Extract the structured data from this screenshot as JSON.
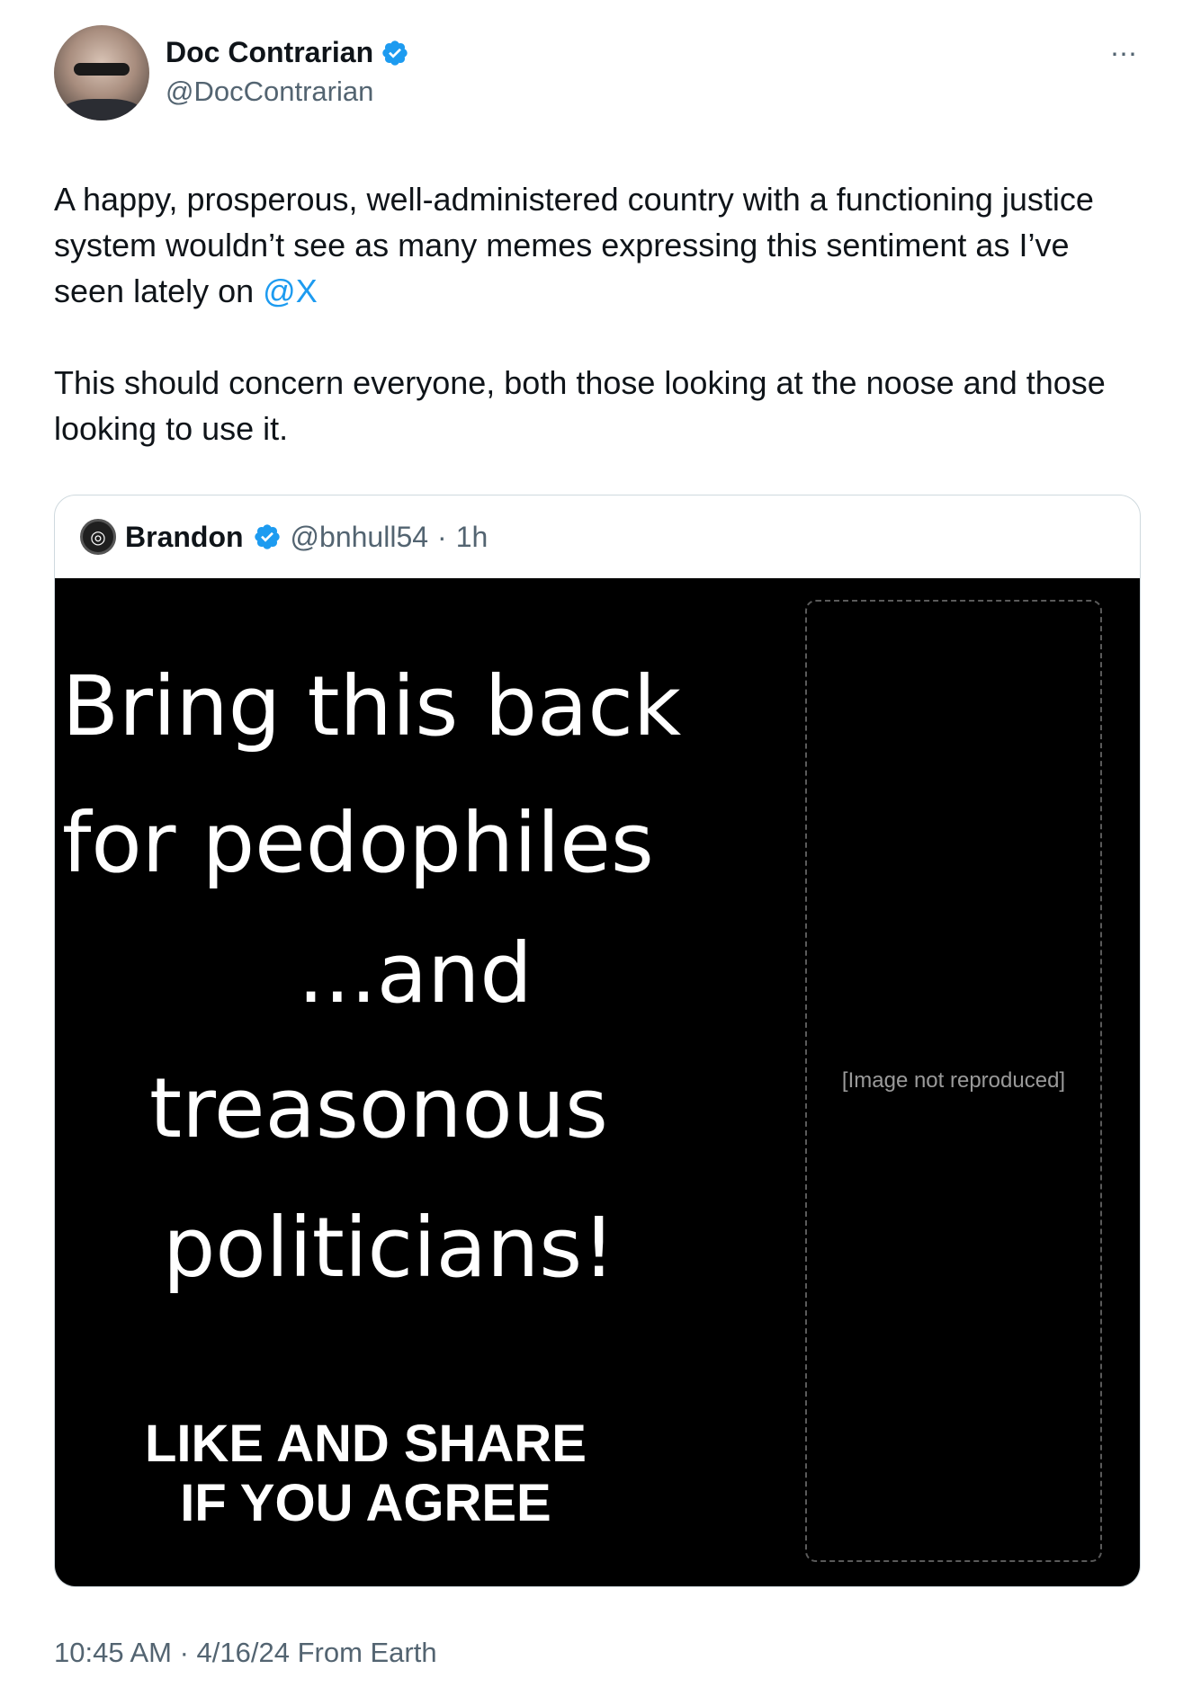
{
  "author": {
    "display_name": "Doc Contrarian",
    "handle": "@DocContrarian",
    "verified": true
  },
  "tweet": {
    "paragraph_1": "A happy, prosperous, well-administered country with a functioning justice system wouldn’t see as many memes expressing this sentiment as I’ve seen lately on ",
    "mention": "@X",
    "paragraph_2": "This should concern everyone, both those looking at the noose and those looking to use it."
  },
  "quote": {
    "display_name": "Brandon",
    "handle": "@bnhull54",
    "separator": "·",
    "time": "1h",
    "verified": true,
    "media": {
      "lines": [
        "Bring this back",
        "for pedophiles",
        "...and",
        "treasonous",
        "politicians!"
      ],
      "cta_1": "LIKE AND SHARE",
      "cta_2": "IF YOU AGREE",
      "placeholder_note": "[Image not reproduced]"
    }
  },
  "meta": {
    "timestamp": "10:45 AM · 4/16/24 From Earth"
  },
  "icons": {
    "verified": "verified-badge-icon",
    "more": "more-options-icon"
  },
  "colors": {
    "accent": "#1d9bf0",
    "secondary_text": "#536471",
    "media_background": "#000000"
  }
}
